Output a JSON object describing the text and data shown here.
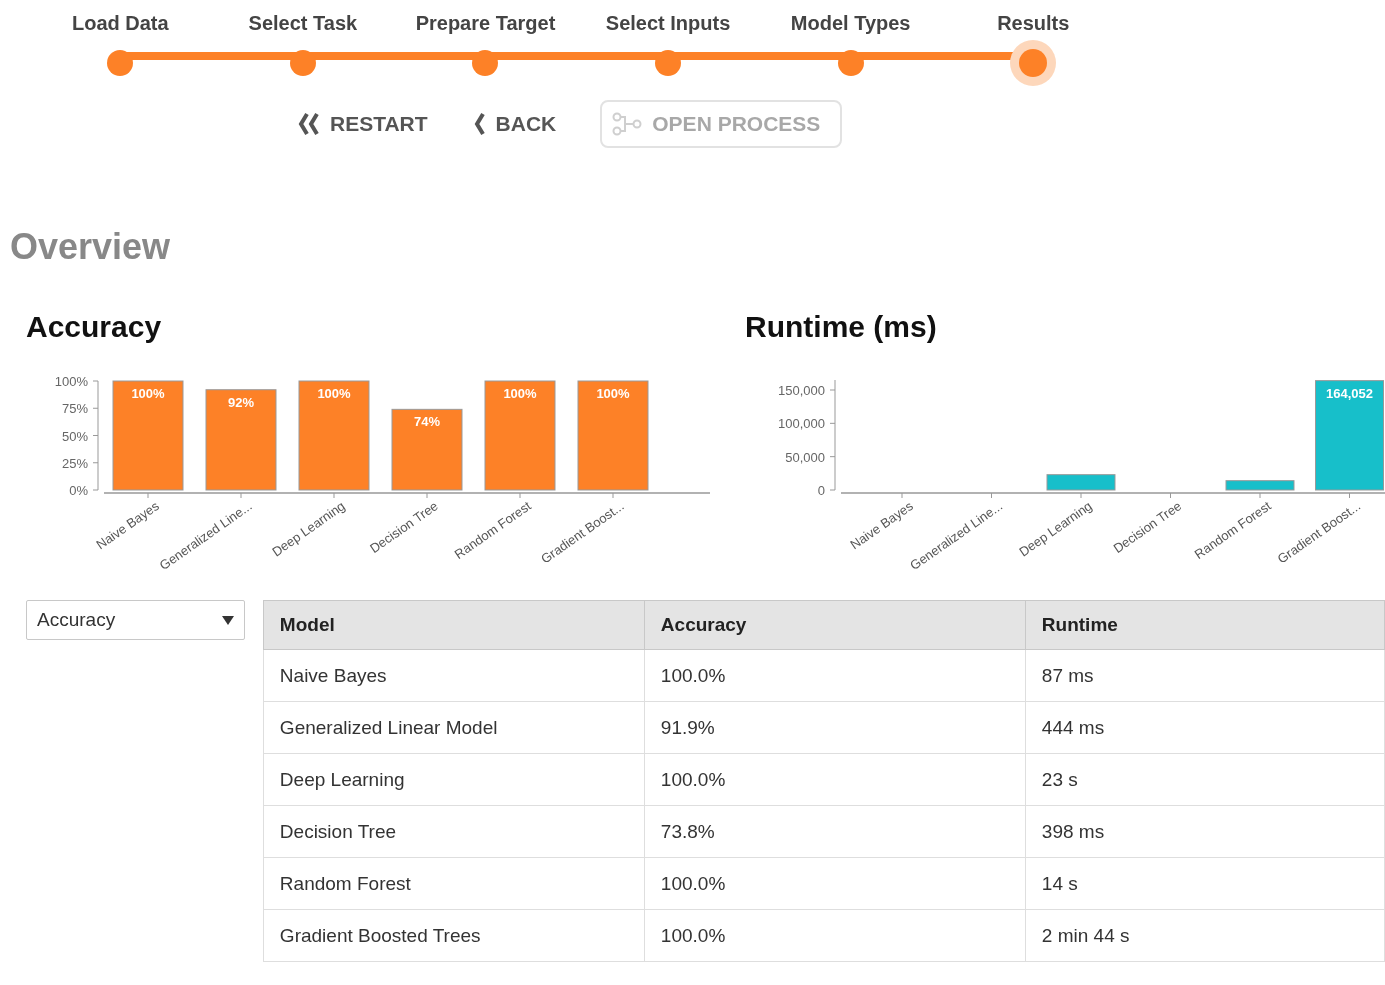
{
  "steps": [
    {
      "label": "Load Data",
      "selected": false
    },
    {
      "label": "Select Task",
      "selected": false
    },
    {
      "label": "Prepare Target",
      "selected": false
    },
    {
      "label": "Select Inputs",
      "selected": false
    },
    {
      "label": "Model Types",
      "selected": false
    },
    {
      "label": "Results",
      "selected": true
    }
  ],
  "actions": [
    {
      "kind": "restart",
      "label": "RESTART",
      "disabled": false
    },
    {
      "kind": "back",
      "label": "BACK",
      "disabled": false
    },
    {
      "kind": "process",
      "label": "OPEN PROCESS",
      "disabled": true
    }
  ],
  "title": "Overview",
  "charts": [
    {
      "heading": "Accuracy",
      "chart_data": {
        "type": "bar",
        "categories": [
          "Naive Bayes",
          "Generalized Line...",
          "Deep Learning",
          "Decision Tree",
          "Random Forest",
          "Gradient Boost..."
        ],
        "series": [
          {
            "color": "#fd8127",
            "values": [
              100,
              92,
              100,
              74,
              100,
              100
            ]
          }
        ],
        "ylim": [
          0,
          100
        ],
        "yticks": [
          {
            "value": 0,
            "label": "0%"
          },
          {
            "value": 25,
            "label": "25%"
          },
          {
            "value": 50,
            "label": "50%"
          },
          {
            "value": 75,
            "label": "75%"
          },
          {
            "value": 100,
            "label": "100%"
          }
        ],
        "value_labels": [
          "100%",
          "92%",
          "100%",
          "74%",
          "100%",
          "100%"
        ]
      }
    },
    {
      "heading": "Runtime (ms)",
      "chart_data": {
        "type": "bar",
        "categories": [
          "Naive Bayes",
          "Generalized Line...",
          "Deep Learning",
          "Decision Tree",
          "Random Forest",
          "Gradient Boost..."
        ],
        "series": [
          {
            "color": "#17bfca",
            "values": [
              0,
              0,
              23000,
              0,
              14000,
              164052
            ]
          }
        ],
        "ylim": [
          0,
          165000
        ],
        "yticks": [
          {
            "value": 0,
            "label": "0"
          },
          {
            "value": 50000,
            "label": "50,000"
          },
          {
            "value": 100000,
            "label": "100,000"
          },
          {
            "value": 150000,
            "label": "150,000"
          }
        ],
        "value_labels": [
          null,
          null,
          null,
          null,
          null,
          "164,052"
        ]
      }
    }
  ],
  "metric_select": {
    "value": "Accuracy"
  },
  "table": {
    "columns": [
      "Model",
      "Accuracy",
      "Runtime"
    ],
    "rows": [
      [
        "Naive Bayes",
        "100.0%",
        "87 ms"
      ],
      [
        "Generalized Linear Model",
        "91.9%",
        "444 ms"
      ],
      [
        "Deep Learning",
        "100.0%",
        "23 s"
      ],
      [
        "Decision Tree",
        "73.8%",
        "398 ms"
      ],
      [
        "Random Forest",
        "100.0%",
        "14 s"
      ],
      [
        "Gradient Boosted Trees",
        "100.0%",
        "2 min 44 s"
      ]
    ]
  }
}
